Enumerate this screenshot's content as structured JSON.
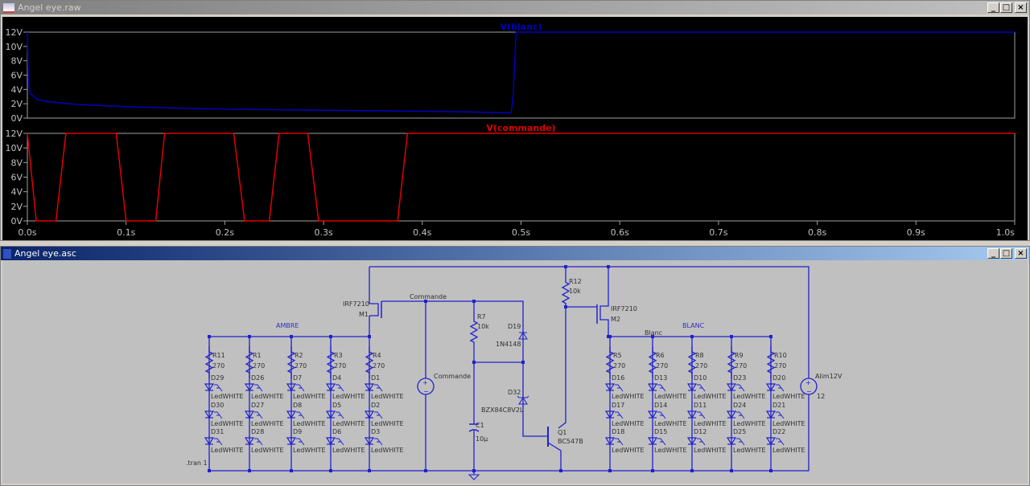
{
  "waveform_window": {
    "title": "Angel eye.raw",
    "controls": [
      "_",
      "□",
      "×"
    ]
  },
  "schematic_window": {
    "title": "Angel eye.asc",
    "controls": [
      "_",
      "□",
      "×"
    ]
  },
  "chart_data": [
    {
      "type": "line",
      "title": "V(blanc)",
      "series": [
        {
          "name": "V(blanc)",
          "color": "#0000c0",
          "x": [
            0,
            0.001,
            0.003,
            0.01,
            0.02,
            0.05,
            0.1,
            0.15,
            0.2,
            0.3,
            0.4,
            0.45,
            0.49,
            0.492,
            0.495,
            0.5,
            1.0
          ],
          "y": [
            12,
            5,
            3.4,
            2.6,
            2.3,
            1.9,
            1.6,
            1.4,
            1.25,
            1.1,
            0.95,
            0.85,
            0.7,
            3,
            12,
            12,
            12
          ]
        }
      ],
      "yticks": [
        "0V",
        "2V",
        "4V",
        "6V",
        "8V",
        "10V",
        "12V"
      ],
      "ylim": [
        0,
        12
      ],
      "xlim": [
        0,
        1.0
      ],
      "grid": false
    },
    {
      "type": "line",
      "title": "V(commande)",
      "series": [
        {
          "name": "V(commande)",
          "color": "#e00000",
          "x": [
            0,
            0.009,
            0.029,
            0.039,
            0.09,
            0.1,
            0.13,
            0.139,
            0.209,
            0.22,
            0.245,
            0.255,
            0.284,
            0.295,
            0.375,
            0.385,
            1.0
          ],
          "y": [
            12,
            0,
            0,
            12,
            12,
            0,
            0,
            12,
            12,
            0,
            0,
            12,
            12,
            0,
            0,
            12,
            12
          ]
        }
      ],
      "yticks": [
        "0V",
        "2V",
        "4V",
        "6V",
        "8V",
        "10V",
        "12V"
      ],
      "xticks": [
        "0.0s",
        "0.1s",
        "0.2s",
        "0.3s",
        "0.4s",
        "0.5s",
        "0.6s",
        "0.7s",
        "0.8s",
        "0.9s",
        "1.0s"
      ],
      "ylim": [
        0,
        12
      ],
      "xlim": [
        0,
        1.0
      ],
      "grid": false
    }
  ],
  "schematic": {
    "net_labels": {
      "ambre": "AMBRE",
      "blanc_upper": "BLANC",
      "blanc": "Blanc",
      "commande": "Commande"
    },
    "directive": ".tran 1",
    "ambre_branches": [
      {
        "r": "R11",
        "rv": "270",
        "d": [
          "D29",
          "D30",
          "D31"
        ]
      },
      {
        "r": "R1",
        "rv": "270",
        "d": [
          "D26",
          "D27",
          "D28"
        ]
      },
      {
        "r": "R2",
        "rv": "270",
        "d": [
          "D7",
          "D8",
          "D9"
        ]
      },
      {
        "r": "R3",
        "rv": "270",
        "d": [
          "D4",
          "D5",
          "D6"
        ]
      },
      {
        "r": "R4",
        "rv": "270",
        "d": [
          "D1",
          "D2",
          "D3"
        ]
      }
    ],
    "blanc_branches": [
      {
        "r": "R5",
        "rv": "270",
        "d": [
          "D16",
          "D17",
          "D18"
        ]
      },
      {
        "r": "R6",
        "rv": "270",
        "d": [
          "D13",
          "D14",
          "D15"
        ]
      },
      {
        "r": "R8",
        "rv": "270",
        "d": [
          "D10",
          "D11",
          "D12"
        ]
      },
      {
        "r": "R9",
        "rv": "270",
        "d": [
          "D23",
          "D24",
          "D25"
        ]
      },
      {
        "r": "R10",
        "rv": "270",
        "d": [
          "D20",
          "D21",
          "D22"
        ]
      }
    ],
    "led_model": "LedWHITE",
    "m1": {
      "name": "M1",
      "model": "IRF7210"
    },
    "m2": {
      "name": "M2",
      "model": "IRF7210"
    },
    "r7": {
      "name": "R7",
      "value": "10k"
    },
    "r12": {
      "name": "R12",
      "value": "10k"
    },
    "d19": {
      "name": "D19",
      "model": "1N4148"
    },
    "d32": {
      "name": "D32",
      "model": "BZX84C8V2L"
    },
    "c1": {
      "name": "C1",
      "value": "10µ"
    },
    "q1": {
      "name": "Q1",
      "model": "BC547B"
    },
    "v_commande": {
      "name": "Commande"
    },
    "v_alim": {
      "name": "Alim12V",
      "value": "12"
    },
    "wire_color": "#2020d0",
    "text_color": "#303030",
    "net_label_color": "#3030c0"
  }
}
